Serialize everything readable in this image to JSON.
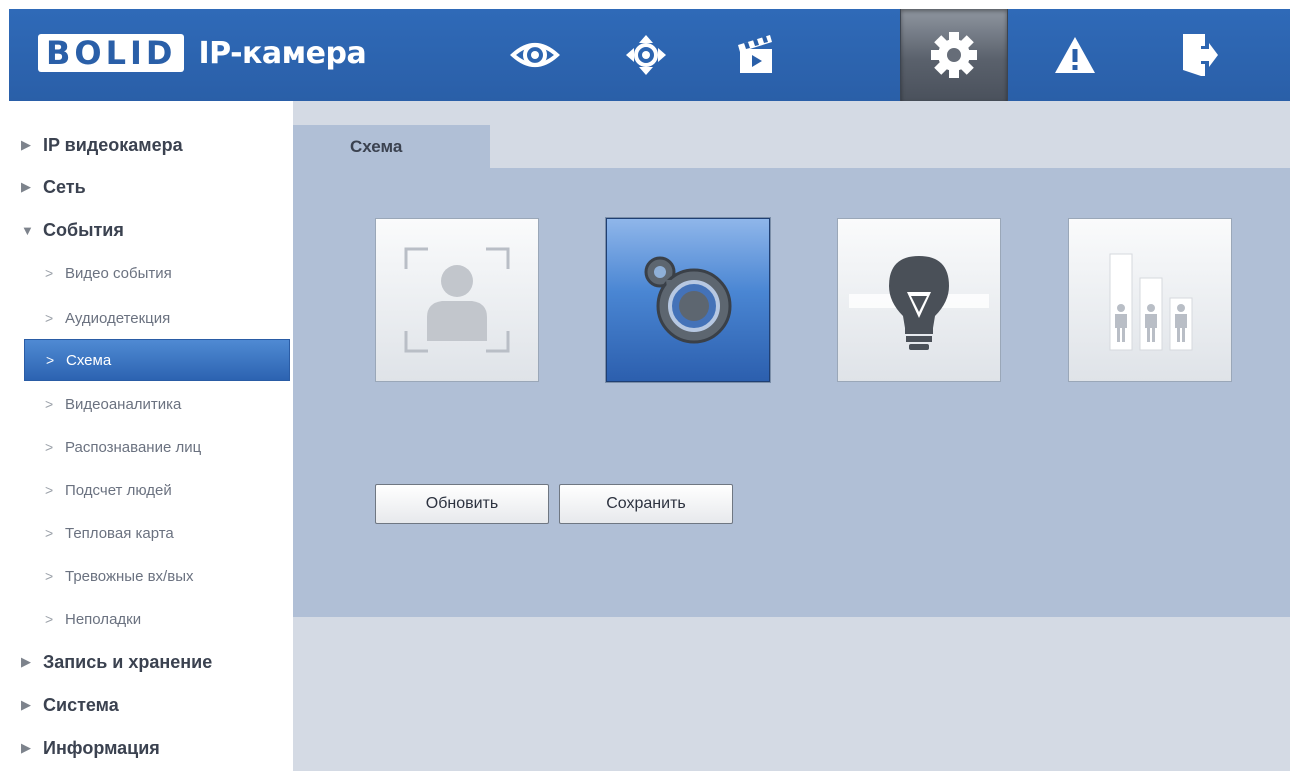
{
  "header": {
    "logo_text": "BOLID",
    "app_title": "IP-камера",
    "nav": [
      {
        "icon": "eye-icon",
        "active": false
      },
      {
        "icon": "ptz-icon",
        "active": false
      },
      {
        "icon": "clapperboard-icon",
        "active": false
      },
      {
        "icon": "gear-icon",
        "active": true
      },
      {
        "icon": "alarm-icon",
        "active": false
      },
      {
        "icon": "logout-icon",
        "active": false
      }
    ]
  },
  "sidebar": {
    "items": [
      {
        "label": "IP видеокамера",
        "level": 1,
        "expanded": false
      },
      {
        "label": "Сеть",
        "level": 1,
        "expanded": false
      },
      {
        "label": "События",
        "level": 1,
        "expanded": true
      },
      {
        "label": "Видео события",
        "level": 2
      },
      {
        "label": "Аудиодетекция",
        "level": 2
      },
      {
        "label": "Схема",
        "level": 2,
        "selected": true
      },
      {
        "label": "Видеоаналитика",
        "level": 2
      },
      {
        "label": "Распознавание лиц",
        "level": 2
      },
      {
        "label": "Подсчет людей",
        "level": 2
      },
      {
        "label": "Тепловая карта",
        "level": 2
      },
      {
        "label": "Тревожные вх/вых",
        "level": 2
      },
      {
        "label": "Неполадки",
        "level": 2
      },
      {
        "label": "Запись и хранение",
        "level": 1,
        "expanded": false
      },
      {
        "label": "Система",
        "level": 1,
        "expanded": false
      },
      {
        "label": "Информация",
        "level": 1,
        "expanded": false
      }
    ]
  },
  "main": {
    "tab_label": "Схема",
    "modes": [
      {
        "icon": "face-recognition-icon",
        "active": false
      },
      {
        "icon": "general-detection-icon",
        "active": true
      },
      {
        "icon": "heatmap-bulb-icon",
        "active": false
      },
      {
        "icon": "people-counting-icon",
        "active": false
      }
    ],
    "buttons": {
      "refresh_label": "Обновить",
      "save_label": "Сохранить"
    }
  },
  "colors": {
    "header_blue": "#2a5fa8",
    "panel_blue": "#b0bfd6",
    "page_bg": "#d4dae4",
    "selected_blue": "#3a73c2"
  }
}
